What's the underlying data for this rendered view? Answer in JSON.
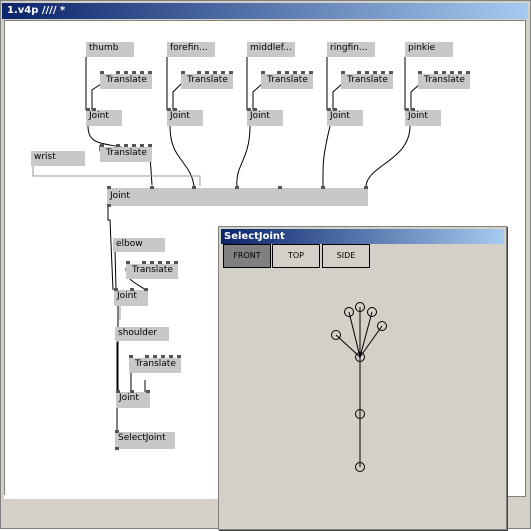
{
  "window": {
    "title": "1.v4p //// *"
  },
  "patch": {
    "io": [
      {
        "id": "thumb",
        "label": "thumb"
      },
      {
        "id": "forefinger",
        "label": "forefin..."
      },
      {
        "id": "middlefinger",
        "label": "middlef..."
      },
      {
        "id": "ringfinger",
        "label": "ringfin..."
      },
      {
        "id": "pinkie",
        "label": "pinkie"
      },
      {
        "id": "wrist",
        "label": "wrist"
      },
      {
        "id": "elbow",
        "label": "elbow"
      },
      {
        "id": "shoulder",
        "label": "shoulder"
      }
    ],
    "translate_label": "Translate",
    "joint_label": "Joint",
    "selectjoint_label": "SelectJoint"
  },
  "selectjoint_window": {
    "title": "SelectJoint",
    "tabs": [
      {
        "label": "FRONT",
        "active": true
      },
      {
        "label": "TOP",
        "active": false
      },
      {
        "label": "SIDE",
        "active": false
      }
    ]
  }
}
